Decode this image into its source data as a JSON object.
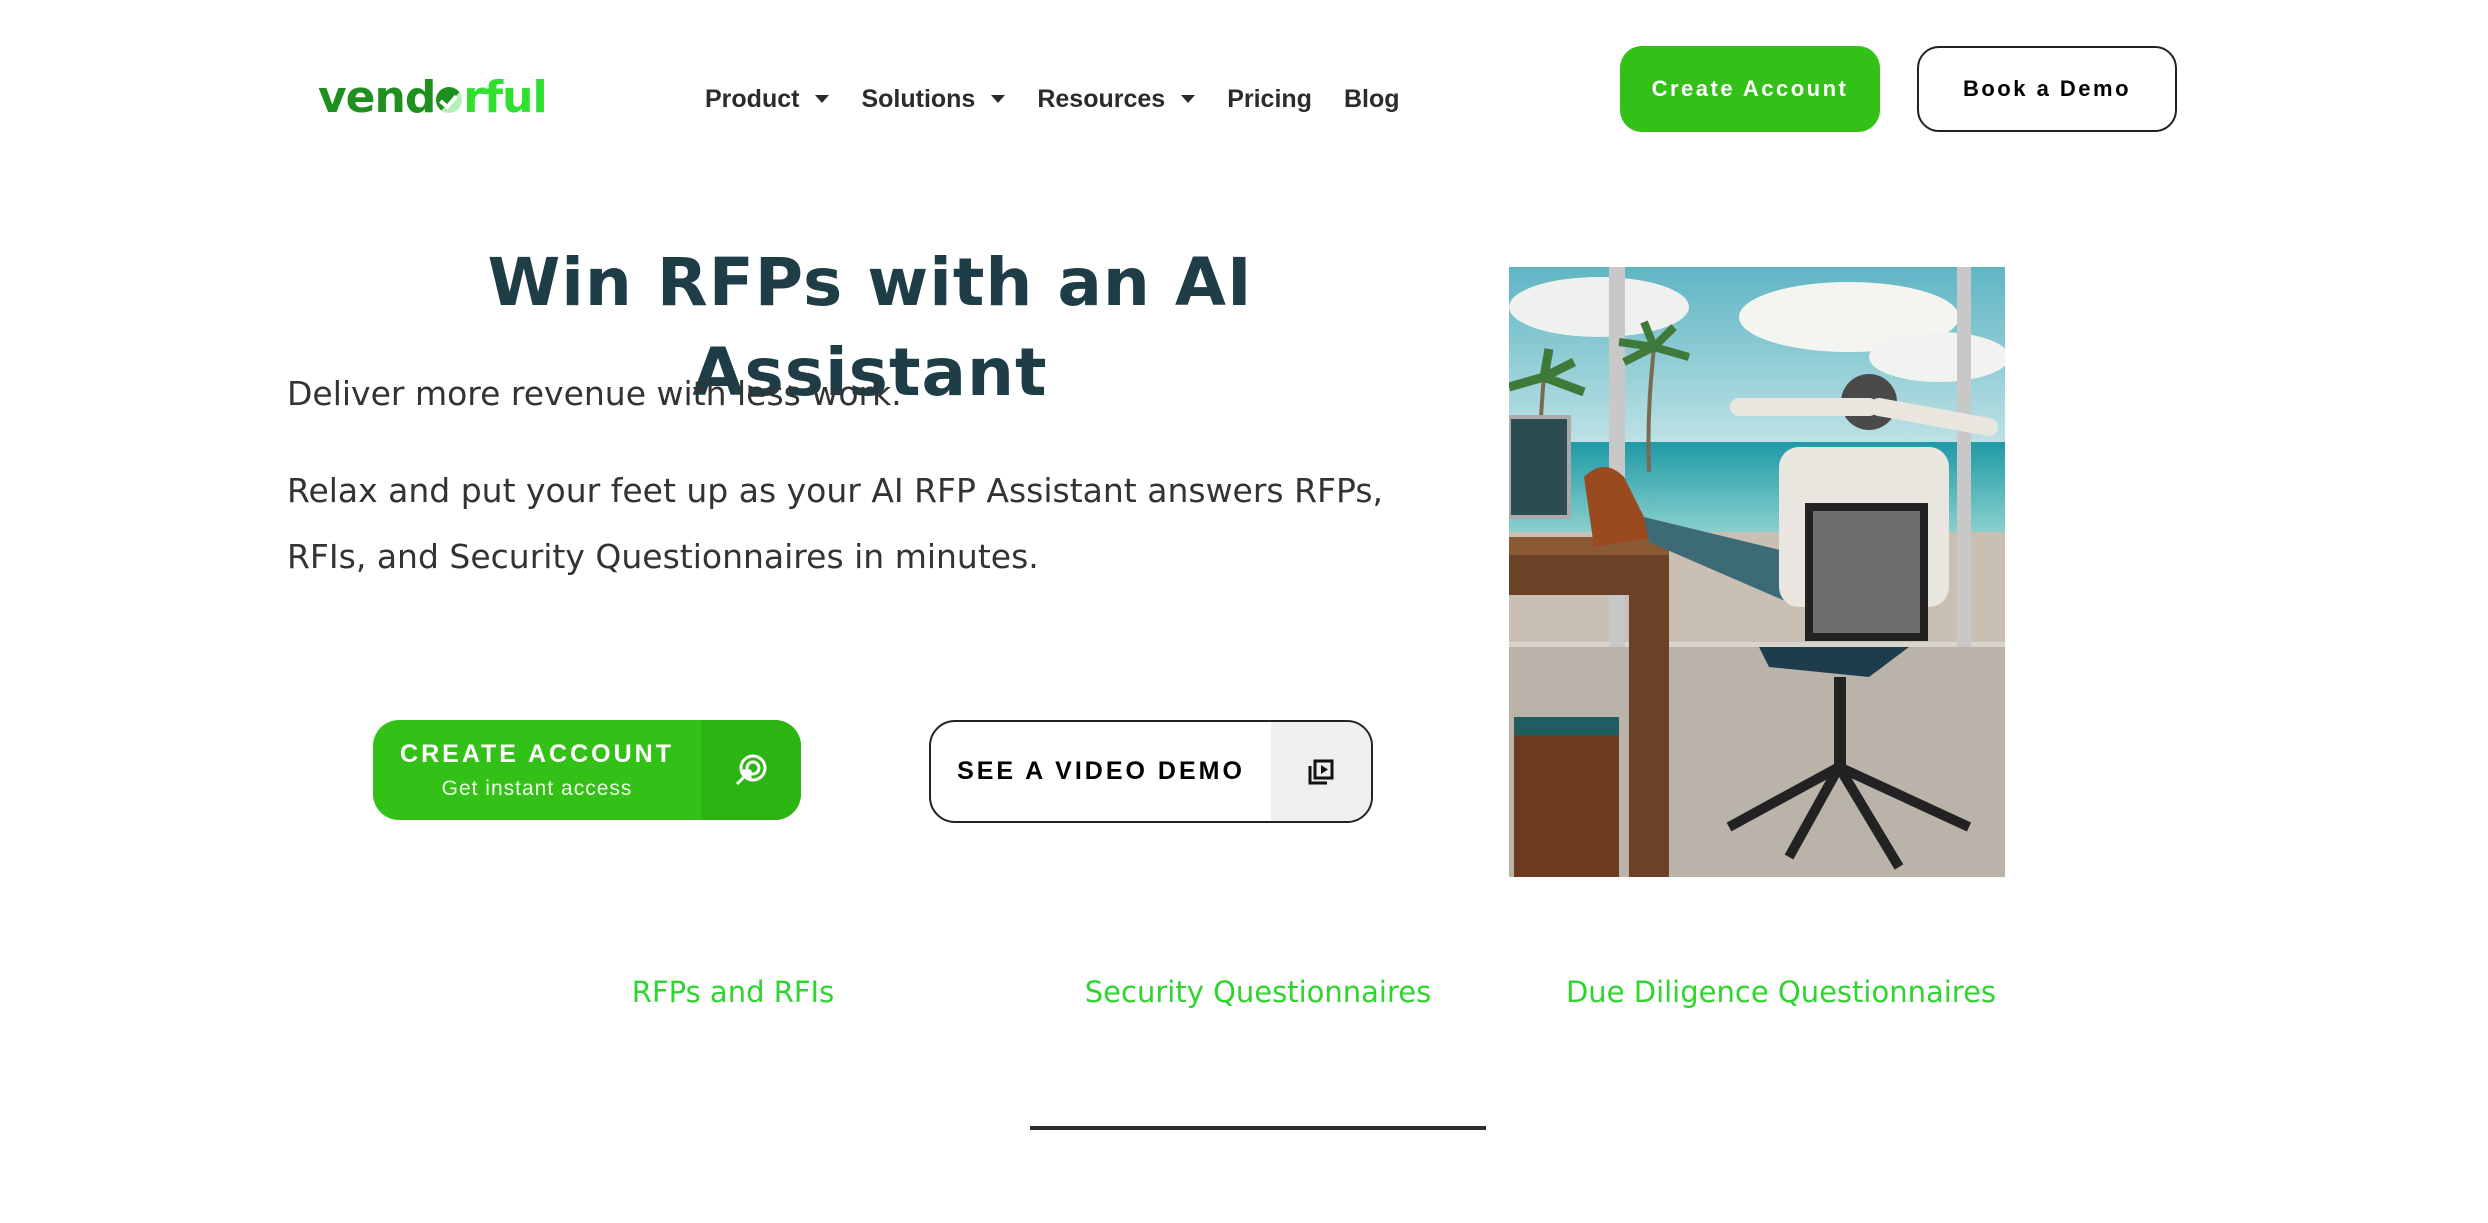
{
  "header": {
    "logo": {
      "part1": "vend",
      "part2": "rful",
      "brand_colors": {
        "dark": "#1f8f1f",
        "light": "#2fe02f"
      }
    },
    "nav": [
      {
        "label": "Product",
        "has_dropdown": true
      },
      {
        "label": "Solutions",
        "has_dropdown": true
      },
      {
        "label": "Resources",
        "has_dropdown": true
      },
      {
        "label": "Pricing",
        "has_dropdown": false
      },
      {
        "label": "Blog",
        "has_dropdown": false
      }
    ],
    "create_account_label": "Create Account",
    "book_demo_label": "Book a Demo"
  },
  "hero": {
    "title": "Win RFPs with an AI Assistant",
    "subtitle": "Deliver more revenue with less work.",
    "paragraph_line1": "Relax and put your feet up as your AI RFP Assistant answers RFPs,",
    "paragraph_line2": "RFIs, and Security Questionnaires in minutes.",
    "cta_create": {
      "title": "CREATE ACCOUNT",
      "subtitle": "Get instant access",
      "icon": "click-target-icon"
    },
    "cta_video": {
      "label": "SEE A VIDEO DEMO",
      "icon": "video-library-icon"
    },
    "image_alt": "Man relaxing with feet on desk overlooking a beach"
  },
  "tabs": {
    "items": [
      {
        "label": "RFPs and RFIs"
      },
      {
        "label": "Security Questionnaires"
      },
      {
        "label": "Due Diligence Questionnaires"
      }
    ],
    "active_index": 1
  },
  "colors": {
    "accent_green": "#33c117",
    "tab_green": "#2fd42f",
    "heading": "#1f3d47",
    "body_text": "#333333"
  }
}
